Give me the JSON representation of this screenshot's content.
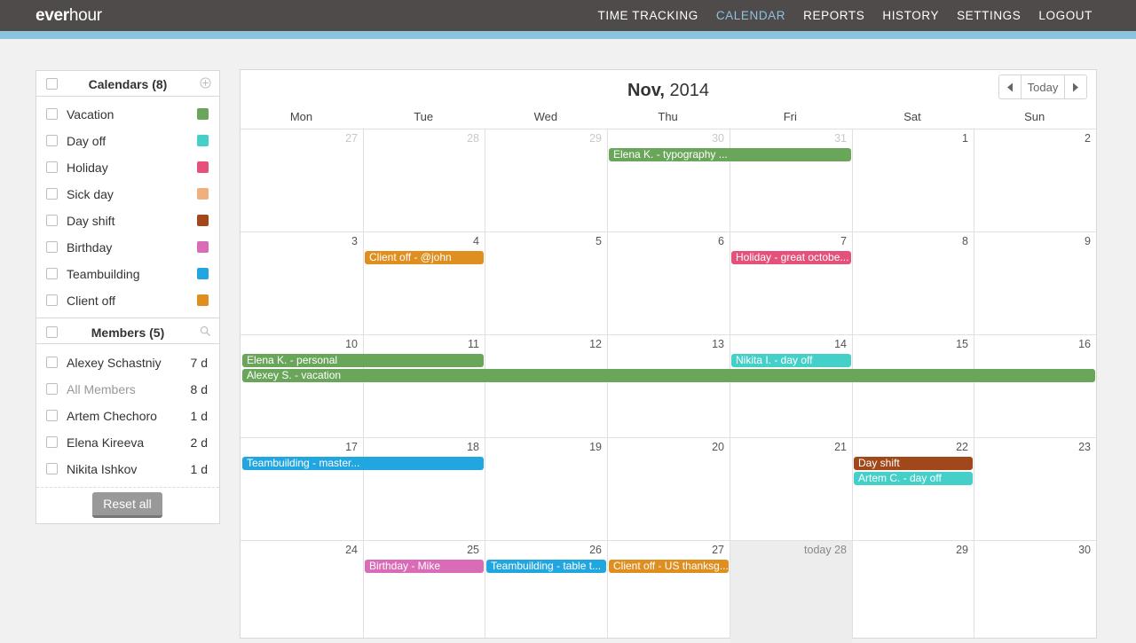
{
  "app": {
    "logo_bold": "ever",
    "logo_rest": "hour"
  },
  "nav": {
    "items": [
      {
        "label": "TIME TRACKING"
      },
      {
        "label": "CALENDAR",
        "active": true
      },
      {
        "label": "REPORTS"
      },
      {
        "label": "HISTORY"
      },
      {
        "label": "SETTINGS"
      },
      {
        "label": "LOGOUT"
      }
    ]
  },
  "sidebar": {
    "calendars_title": "Calendars (8)",
    "calendars": [
      {
        "label": "Vacation",
        "color": "#6aa65a"
      },
      {
        "label": "Day off",
        "color": "#45cfc9"
      },
      {
        "label": "Holiday",
        "color": "#e4527b"
      },
      {
        "label": "Sick day",
        "color": "#f0b07d"
      },
      {
        "label": "Day shift",
        "color": "#a04819"
      },
      {
        "label": "Birthday",
        "color": "#d96bb7"
      },
      {
        "label": "Teambuilding",
        "color": "#22a6e0"
      },
      {
        "label": "Client off",
        "color": "#de8f1f"
      }
    ],
    "members_title": "Members (5)",
    "members": [
      {
        "label": "Alexey Schastniy",
        "days": "7 d"
      },
      {
        "label": "All Members",
        "days": "8 d",
        "muted": true
      },
      {
        "label": "Artem Chechoro",
        "days": "1 d"
      },
      {
        "label": "Elena Kireeva",
        "days": "2 d"
      },
      {
        "label": "Nikita Ishkov",
        "days": "1 d"
      }
    ],
    "reset_label": "Reset all"
  },
  "calendar": {
    "month": "Nov,",
    "year": "2014",
    "today_label": "Today",
    "weekdays": [
      "Mon",
      "Tue",
      "Wed",
      "Thu",
      "Fri",
      "Sat",
      "Sun"
    ],
    "weeks": [
      [
        {
          "d": "27",
          "m": true
        },
        {
          "d": "28",
          "m": true
        },
        {
          "d": "29",
          "m": true
        },
        {
          "d": "30",
          "m": true
        },
        {
          "d": "31",
          "m": true
        },
        {
          "d": "1"
        },
        {
          "d": "2"
        }
      ],
      [
        {
          "d": "3"
        },
        {
          "d": "4"
        },
        {
          "d": "5"
        },
        {
          "d": "6"
        },
        {
          "d": "7"
        },
        {
          "d": "8"
        },
        {
          "d": "9"
        }
      ],
      [
        {
          "d": "10"
        },
        {
          "d": "11"
        },
        {
          "d": "12"
        },
        {
          "d": "13"
        },
        {
          "d": "14"
        },
        {
          "d": "15"
        },
        {
          "d": "16"
        }
      ],
      [
        {
          "d": "17"
        },
        {
          "d": "18"
        },
        {
          "d": "19"
        },
        {
          "d": "20"
        },
        {
          "d": "21"
        },
        {
          "d": "22"
        },
        {
          "d": "23"
        }
      ],
      [
        {
          "d": "24"
        },
        {
          "d": "25"
        },
        {
          "d": "26"
        },
        {
          "d": "27"
        },
        {
          "d": "today 28",
          "today": true
        },
        {
          "d": "29"
        },
        {
          "d": "30"
        }
      ]
    ],
    "events": [
      {
        "label": "Elena K. - typography ...",
        "week": 0,
        "start": 3,
        "span": 2,
        "lane": 0,
        "color": "#6aa65a"
      },
      {
        "label": "Client off - @john",
        "week": 1,
        "start": 1,
        "span": 1,
        "lane": 0,
        "color": "#de8f1f"
      },
      {
        "label": "Holiday - great octobe...",
        "week": 1,
        "start": 4,
        "span": 1,
        "lane": 0,
        "color": "#e4527b"
      },
      {
        "label": "Elena K. - personal",
        "week": 2,
        "start": 0,
        "span": 2,
        "lane": 0,
        "color": "#6aa65a"
      },
      {
        "label": "Nikita I. - day off",
        "week": 2,
        "start": 4,
        "span": 1,
        "lane": 0,
        "color": "#45cfc9"
      },
      {
        "label": "Alexey S. - vacation",
        "week": 2,
        "start": 0,
        "span": 7,
        "lane": 1,
        "color": "#6aa65a"
      },
      {
        "label": "Teambuilding - master...",
        "week": 3,
        "start": 0,
        "span": 2,
        "lane": 0,
        "color": "#22a6e0"
      },
      {
        "label": "Day shift",
        "week": 3,
        "start": 5,
        "span": 1,
        "lane": 0,
        "color": "#a04819"
      },
      {
        "label": "Artem C. - day off",
        "week": 3,
        "start": 5,
        "span": 1,
        "lane": 1,
        "color": "#45cfc9"
      },
      {
        "label": "Birthday - Mike",
        "week": 4,
        "start": 1,
        "span": 1,
        "lane": 0,
        "color": "#d96bb7"
      },
      {
        "label": "Teambuilding - table t...",
        "week": 4,
        "start": 2,
        "span": 1,
        "lane": 0,
        "color": "#22a6e0"
      },
      {
        "label": "Client off - US thanksg...",
        "week": 4,
        "start": 3,
        "span": 1,
        "lane": 0,
        "color": "#de8f1f"
      }
    ]
  }
}
